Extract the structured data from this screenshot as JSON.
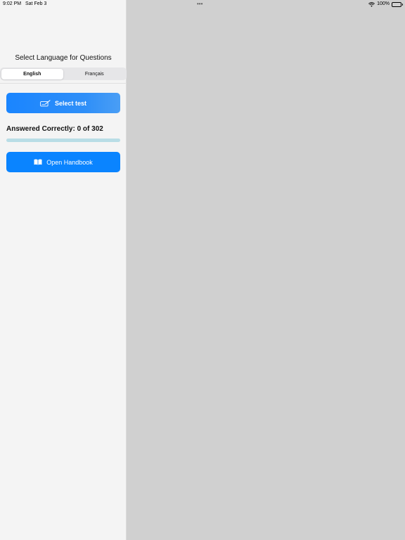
{
  "status_bar": {
    "time": "9:02 PM",
    "date": "Sat Feb 3",
    "multitask_dots": "•••",
    "battery_percent": "100%",
    "icons": [
      "wifi-icon",
      "battery-icon"
    ]
  },
  "sidebar": {
    "language_heading": "Select Language for Questions",
    "language_options": [
      "English",
      "Français"
    ],
    "selected_language": "English",
    "select_test_label": "Select test",
    "select_test_icon": "ticket-pencil-icon",
    "answered_text": "Answered Correctly: 0 of 302",
    "answered_correct": 0,
    "answered_total": 302,
    "progress_fraction": 0,
    "open_handbook_label": "Open Handbook",
    "open_handbook_icon": "book-icon"
  },
  "colors": {
    "accent": "#0a84ff",
    "progress_track": "#b9dde6",
    "sidebar_bg": "#f4f4f4",
    "detail_bg": "#d0d0d0"
  }
}
